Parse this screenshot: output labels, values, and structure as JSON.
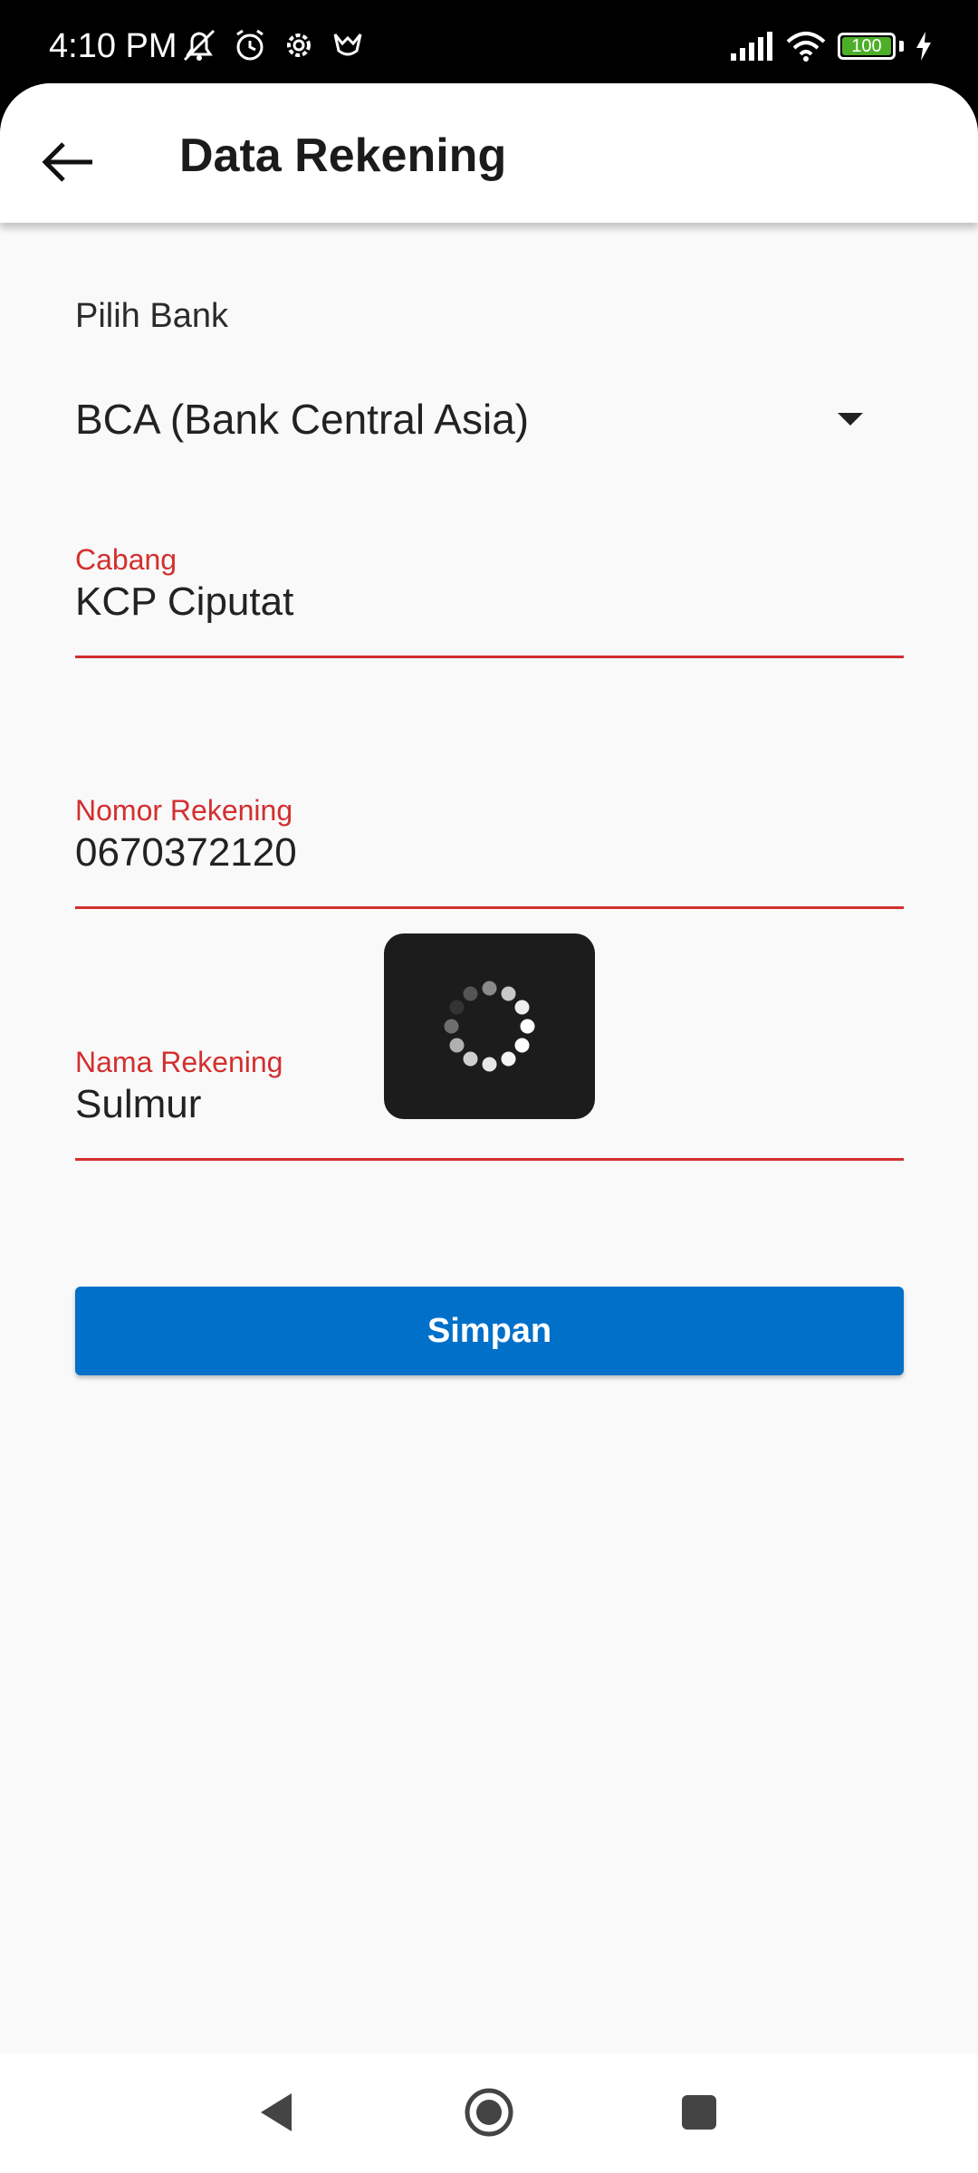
{
  "status_bar": {
    "time": "4:10 PM",
    "icons_left": [
      "muted-bell-icon",
      "alarm-icon",
      "settings-icon",
      "app-notification-icon"
    ],
    "icons_right": [
      "signal-icon",
      "wifi-icon",
      "battery-icon",
      "charging-icon"
    ],
    "battery_level": "100"
  },
  "app_bar": {
    "title": "Data Rekening",
    "back_icon": "arrow-left-icon"
  },
  "form": {
    "bank": {
      "label": "Pilih Bank",
      "selected": "BCA (Bank Central Asia)"
    },
    "cabang": {
      "label": "Cabang",
      "value": "KCP Ciputat"
    },
    "nomor_rekening": {
      "label": "Nomor Rekening",
      "value": "0670372120"
    },
    "nama_rekening": {
      "label": "Nama Rekening",
      "value": "Sulmur"
    },
    "save_label": "Simpan"
  },
  "colors": {
    "accent_red": "#d32f2f",
    "button_blue": "#0070c9",
    "battery_green": "#4caf27"
  },
  "nav_bar": {
    "icons": [
      "back-triangle-icon",
      "home-circle-icon",
      "recents-square-icon"
    ]
  }
}
